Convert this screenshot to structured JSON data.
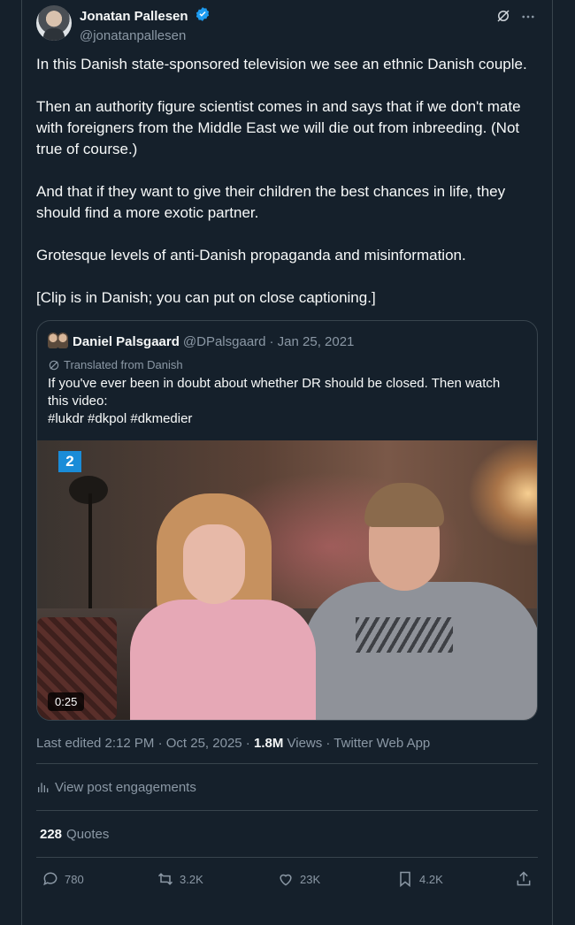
{
  "author": {
    "name": "Jonatan Pallesen",
    "handle": "@jonatanpallesen"
  },
  "tweet": {
    "paragraphs": [
      "In this Danish state-sponsored television we see an ethnic Danish couple.",
      "Then an authority figure scientist comes in and says that if we don't mate with foreigners from the Middle East we will die out from inbreeding. (Not true of course.)",
      "And that if they want to give their children the best chances in life, they should find a more exotic partner.",
      "Grotesque levels of anti-Danish propaganda and misinformation.",
      "[Clip is in Danish; you can put on close captioning.]"
    ]
  },
  "quote": {
    "name": "Daniel Palsgaard",
    "handle": "@DPalsgaard",
    "date": "· Jan 25, 2021",
    "translated_label": "Translated from Danish",
    "text_lines": [
      "If you've ever been in doubt about whether DR should be closed. Then watch",
      "this video:",
      "#lukdr #dkpol #dkmedier"
    ],
    "media": {
      "channel_badge": "2",
      "duration": "0:25"
    }
  },
  "meta": {
    "edited": "Last edited 2:12 PM · Oct 25, 2025 · ",
    "views_count": "1.8M",
    "views_label": " Views · Twitter Web App"
  },
  "engagements_link": "View post engagements",
  "quotes": {
    "count": "228",
    "label": "Quotes"
  },
  "actions": {
    "replies": "780",
    "reposts": "3.2K",
    "likes": "23K",
    "bookmarks": "4.2K"
  },
  "colors": {
    "background": "#15202b",
    "border": "#38444d",
    "secondary_text": "#8b98a5",
    "verified": "#1d9bf0"
  }
}
